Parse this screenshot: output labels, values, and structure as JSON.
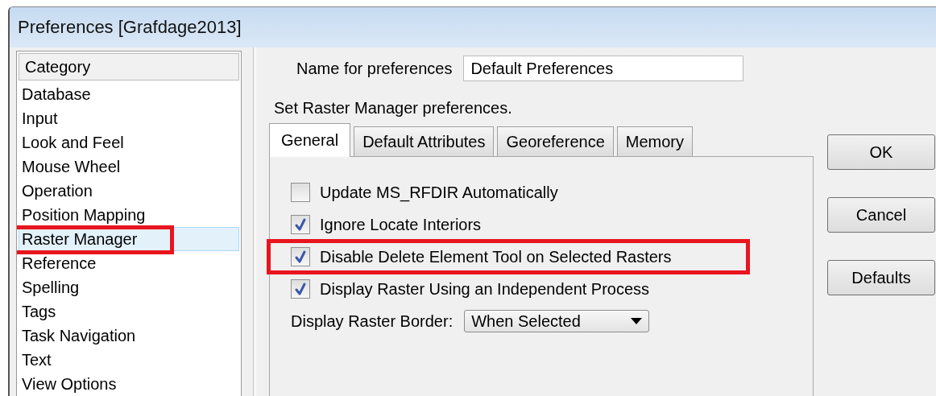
{
  "window": {
    "title": "Preferences [Grafdage2013]"
  },
  "category_list": {
    "header": "Category",
    "items": [
      {
        "label": "Database",
        "selected": false,
        "highlight": false
      },
      {
        "label": "Input",
        "selected": false,
        "highlight": false
      },
      {
        "label": "Look and Feel",
        "selected": false,
        "highlight": false
      },
      {
        "label": "Mouse Wheel",
        "selected": false,
        "highlight": false
      },
      {
        "label": "Operation",
        "selected": false,
        "highlight": false
      },
      {
        "label": "Position Mapping",
        "selected": false,
        "highlight": false
      },
      {
        "label": "Raster Manager",
        "selected": true,
        "highlight": true
      },
      {
        "label": "Reference",
        "selected": false,
        "highlight": false
      },
      {
        "label": "Spelling",
        "selected": false,
        "highlight": false
      },
      {
        "label": "Tags",
        "selected": false,
        "highlight": false
      },
      {
        "label": "Task Navigation",
        "selected": false,
        "highlight": false
      },
      {
        "label": "Text",
        "selected": false,
        "highlight": false
      },
      {
        "label": "View Options",
        "selected": false,
        "highlight": false
      }
    ]
  },
  "name_field": {
    "label": "Name for preferences",
    "value": "Default Preferences"
  },
  "description": "Set Raster Manager preferences.",
  "tabs": [
    {
      "label": "General",
      "selected": true
    },
    {
      "label": "Default Attributes",
      "selected": false
    },
    {
      "label": "Georeference",
      "selected": false
    },
    {
      "label": "Memory",
      "selected": false
    }
  ],
  "options": [
    {
      "label": "Update MS_RFDIR Automatically",
      "checked": false,
      "highlight": false
    },
    {
      "label": "Ignore Locate Interiors",
      "checked": true,
      "highlight": false
    },
    {
      "label": "Disable Delete Element Tool on Selected Rasters",
      "checked": true,
      "highlight": true
    },
    {
      "label": "Display Raster Using an Independent Process",
      "checked": true,
      "highlight": false
    }
  ],
  "border_dropdown": {
    "label": "Display Raster Border:",
    "value": "When Selected"
  },
  "buttons": [
    "OK",
    "Cancel",
    "Defaults"
  ]
}
